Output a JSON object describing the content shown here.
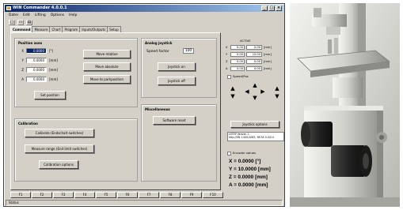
{
  "window": {
    "title": "WIN Commander 4.0.0.1",
    "controls": [
      "_",
      "□",
      "×"
    ]
  },
  "menu": [
    "Datei",
    "Edit",
    "Lifting",
    "Options",
    "Help"
  ],
  "toolbar": [
    "□",
    "▭",
    "▤"
  ],
  "tabs": [
    "Command",
    "Measure",
    "Chart",
    "Program",
    "Inputs/Outputs",
    "Setup"
  ],
  "position": {
    "title": "Position axes",
    "rows": [
      {
        "axis": "X",
        "value": "0.0000",
        "unit": "[°]"
      },
      {
        "axis": "Y",
        "value": "0.0000",
        "unit": "[mm]"
      },
      {
        "axis": "Z",
        "value": "0.0000",
        "unit": "[mm]"
      },
      {
        "axis": "A",
        "value": "0.0000",
        "unit": "[mm]"
      }
    ],
    "buttons": {
      "relative": "Move relative",
      "absolute": "Move absolute",
      "reference": "Move to parkposition",
      "set_position": "Set position"
    }
  },
  "joystick": {
    "title": "Analog joystick",
    "speed_label": "Speed factor",
    "speed_value": "100",
    "on": "Joystick on",
    "off": "Joystick off"
  },
  "calibration": {
    "title": "Calibration",
    "calibrate": "Calibrate (Endschalt switches)",
    "measure": "Measure range (End limit switches)",
    "options": "Calibration options"
  },
  "misc": {
    "title": "Miscellaneous",
    "software_reset": "Software reset"
  },
  "function_keys": [
    "F1",
    "F2",
    "F3",
    "F4",
    "F5",
    "F6",
    "F7",
    "F8",
    "F9",
    "F10"
  ],
  "status": "Status",
  "side": {
    "header": "ACTIVE",
    "rows": [
      {
        "axis": "X",
        "value": "0.00",
        "value2": "0.00",
        "unit": "[mm]"
      },
      {
        "axis": "Y",
        "value": "0.00",
        "value2": "10.00",
        "unit": "[mm]"
      },
      {
        "axis": "Z",
        "value": "0.00",
        "value2": "0.00",
        "unit": "[mm]"
      },
      {
        "axis": "A",
        "value": "0.00",
        "value2": "0.00",
        "unit": "[mm]"
      }
    ],
    "speed_label": "Speed/Pos",
    "joystick_options": "Joystick options",
    "info": "LSTEP Version 1.\nhttp://SN 1.000.0063, 98 RS 0.0/0.0",
    "encoder_label": "Encoder values",
    "readouts": [
      "X = 0.0000 [°]",
      "Y = 10.0000 [mm]",
      "Z = 0.0000 [mm]",
      "A = 0.0000 [mm]"
    ]
  },
  "colors": {
    "window_bg": "#d4d0c8",
    "title_bar": "#0a246a",
    "selection": "#0a246a"
  }
}
